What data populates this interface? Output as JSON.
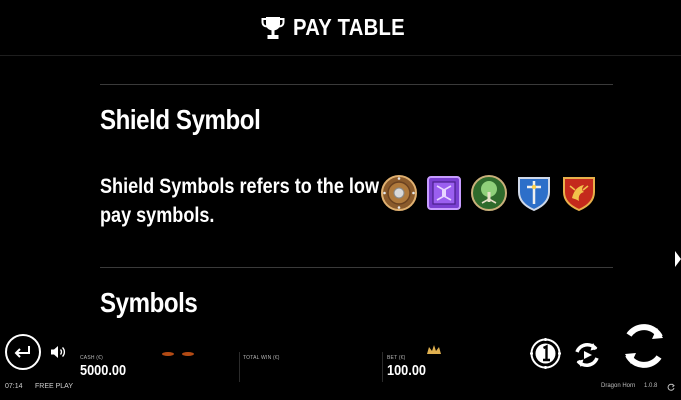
{
  "header": {
    "title": "PAY TABLE",
    "icon": "trophy-icon"
  },
  "paytable": {
    "section1_title": "Shield Symbol",
    "section1_description": "Shield Symbols refers to the low pay symbols.",
    "section2_title": "Symbols",
    "symbols": [
      "round-shield-icon",
      "purple-shield-icon",
      "tree-shield-icon",
      "sword-shield-icon",
      "dragon-shield-icon"
    ]
  },
  "footer": {
    "cash_label": "CASH (€)",
    "cash_value": "5000.00",
    "total_win_label": "TOTAL WIN (€)",
    "total_win_value": "",
    "bet_label": "BET (€)",
    "bet_value": "100.00",
    "time": "07:14",
    "mode": "FREE PLAY",
    "game_name": "Dragon Horn",
    "version": "1.0.8"
  },
  "colors": {
    "background": "#000000",
    "text": "#ffffff",
    "divider": "#3a3a3a"
  }
}
